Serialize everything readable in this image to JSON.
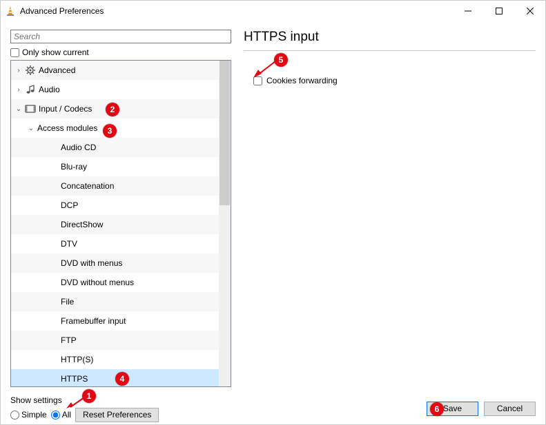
{
  "window": {
    "title": "Advanced Preferences",
    "min_tooltip": "Minimize",
    "max_tooltip": "Maximize",
    "close_tooltip": "Close"
  },
  "search": {
    "placeholder": "Search",
    "value": ""
  },
  "only_show_current_label": "Only show current",
  "only_show_current_checked": false,
  "tree": {
    "items": [
      {
        "label": "Advanced",
        "icon": "gear-icon",
        "level": 1,
        "expand": ">",
        "selected": false
      },
      {
        "label": "Audio",
        "icon": "note-icon",
        "level": 1,
        "expand": ">",
        "selected": false
      },
      {
        "label": "Input / Codecs",
        "icon": "codec-icon",
        "level": 1,
        "expand": "v",
        "selected": false
      },
      {
        "label": "Access modules",
        "icon": "",
        "level": 2,
        "expand": "v",
        "selected": false
      },
      {
        "label": "Audio CD",
        "icon": "",
        "level": 3,
        "expand": "",
        "selected": false
      },
      {
        "label": "Blu-ray",
        "icon": "",
        "level": 3,
        "expand": "",
        "selected": false
      },
      {
        "label": "Concatenation",
        "icon": "",
        "level": 3,
        "expand": "",
        "selected": false
      },
      {
        "label": "DCP",
        "icon": "",
        "level": 3,
        "expand": "",
        "selected": false
      },
      {
        "label": "DirectShow",
        "icon": "",
        "level": 3,
        "expand": "",
        "selected": false
      },
      {
        "label": "DTV",
        "icon": "",
        "level": 3,
        "expand": "",
        "selected": false
      },
      {
        "label": "DVD with menus",
        "icon": "",
        "level": 3,
        "expand": "",
        "selected": false
      },
      {
        "label": "DVD without menus",
        "icon": "",
        "level": 3,
        "expand": "",
        "selected": false
      },
      {
        "label": "File",
        "icon": "",
        "level": 3,
        "expand": "",
        "selected": false
      },
      {
        "label": "Framebuffer input",
        "icon": "",
        "level": 3,
        "expand": "",
        "selected": false
      },
      {
        "label": "FTP",
        "icon": "",
        "level": 3,
        "expand": "",
        "selected": false
      },
      {
        "label": "HTTP(S)",
        "icon": "",
        "level": 3,
        "expand": "",
        "selected": false
      },
      {
        "label": "HTTPS",
        "icon": "",
        "level": 3,
        "expand": "",
        "selected": true
      }
    ]
  },
  "section": {
    "title": "HTTPS input",
    "setting_label": "Cookies forwarding",
    "setting_checked": false
  },
  "footer": {
    "show_settings_label": "Show settings",
    "simple_label": "Simple",
    "all_label": "All",
    "mode_selected": "All",
    "reset_label": "Reset Preferences",
    "save_label": "Save",
    "cancel_label": "Cancel"
  },
  "annotations": {
    "1": "1",
    "2": "2",
    "3": "3",
    "4": "4",
    "5": "5",
    "6": "6"
  }
}
